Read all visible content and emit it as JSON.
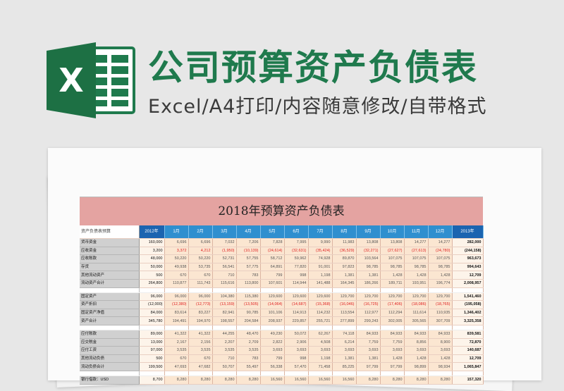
{
  "header": {
    "title": "公司预算资产负债表",
    "subtitle": "Excel/A4打印/内容随意修改/自带格式",
    "logo_letter": "X"
  },
  "colors": {
    "brand_green": "#1f7a4d",
    "sheet_title_bg": "#e4a3a1",
    "month_header": "#2f8fcf",
    "year_header": "#1b64b0",
    "negative": "#e02020"
  },
  "sheet": {
    "title": "2018年预算资产负债表",
    "corner_label": "资产负债表预算",
    "columns": [
      "2012年",
      "1月",
      "2月",
      "3月",
      "4月",
      "5月",
      "6月",
      "7月",
      "8月",
      "9月",
      "10月",
      "11月",
      "12月",
      "2013年"
    ],
    "groups": [
      {
        "rows": [
          {
            "label": "货币资金",
            "first": "160,000",
            "months": [
              "6,696",
              "6,696",
              "7,032",
              "7,206",
              "7,828",
              "7,995",
              "9,990",
              "11,983",
              "13,808",
              "13,808",
              "14,277",
              "14,277"
            ],
            "last": "282,000"
          },
          {
            "label": "应收资金",
            "first": "3,200",
            "months": [
              "3,372",
              "4,212",
              "(1,950)",
              "(10,139)",
              "(24,614)",
              "(32,631)",
              "(35,424)",
              "(36,529)",
              "(32,271)",
              "(27,627)",
              "(27,613)",
              "(24,780)"
            ],
            "last": "(244,158)",
            "neg": true
          },
          {
            "label": "应收账款",
            "first": "48,000",
            "months": [
              "50,220",
              "50,220",
              "52,731",
              "57,755",
              "58,712",
              "59,962",
              "74,928",
              "89,870",
              "103,564",
              "107,075",
              "107,075",
              "107,075"
            ],
            "last": "963,673"
          },
          {
            "label": "存货",
            "first": "50,000",
            "months": [
              "49,938",
              "53,735",
              "56,541",
              "57,775",
              "64,891",
              "77,820",
              "91,001",
              "97,823",
              "98,785",
              "98,785",
              "98,785",
              "98,785"
            ],
            "last": "994,643"
          },
          {
            "label": "其他流动资产",
            "first": "500",
            "months": [
              "670",
              "670",
              "710",
              "783",
              "799",
              "998",
              "1,198",
              "1,381",
              "1,381",
              "1,428",
              "1,428",
              "1,428"
            ],
            "last": "12,709"
          },
          {
            "label": "流动资产合计",
            "first": "264,800",
            "months": [
              "110,877",
              "111,743",
              "115,616",
              "113,800",
              "107,601",
              "114,944",
              "141,488",
              "164,345",
              "186,266",
              "189,711",
              "193,951",
              "196,774"
            ],
            "last": "2,008,957"
          }
        ]
      },
      {
        "rows": [
          {
            "label": "固定资产",
            "first": "96,000",
            "months": [
              "96,000",
              "96,000",
              "104,380",
              "115,380",
              "129,600",
              "129,600",
              "129,600",
              "129,700",
              "129,700",
              "129,700",
              "129,700",
              "129,700"
            ],
            "last": "1,541,460"
          },
          {
            "label": "资产折旧",
            "first": "(12,000)",
            "months": [
              "(12,380)",
              "(12,773)",
              "(13,159)",
              "(13,505)",
              "(14,064)",
              "(14,687)",
              "(15,368)",
              "(16,046)",
              "(16,725)",
              "(17,406)",
              "(18,086)",
              "(18,765)"
            ],
            "last": "(195,058)",
            "neg": true
          },
          {
            "label": "固定资产净值",
            "first": "84,000",
            "months": [
              "83,614",
              "83,227",
              "82,941",
              "90,785",
              "101,106",
              "114,913",
              "114,232",
              "113,554",
              "112,977",
              "112,294",
              "111,614",
              "110,935"
            ],
            "last": "1,346,402"
          },
          {
            "label": "资产合计",
            "first": "345,780",
            "months": [
              "194,491",
              "194,970",
              "198,557",
              "204,584",
              "208,937",
              "229,857",
              "255,721",
              "277,899",
              "299,243",
              "302,005",
              "305,565",
              "307,709"
            ],
            "last": "3,325,358"
          }
        ]
      },
      {
        "rows": [
          {
            "label": "应付账款",
            "first": "89,000",
            "months": [
              "41,322",
              "41,322",
              "44,255",
              "48,470",
              "49,230",
              "50,072",
              "62,267",
              "74,118",
              "84,933",
              "84,933",
              "84,933",
              "84,933"
            ],
            "last": "839,581"
          },
          {
            "label": "应交税金",
            "first": "13,000",
            "months": [
              "2,167",
              "2,156",
              "2,207",
              "2,709",
              "2,822",
              "2,906",
              "4,508",
              "6,214",
              "7,759",
              "7,759",
              "8,856",
              "8,900"
            ],
            "last": "72,870"
          },
          {
            "label": "应付工资",
            "first": "97,000",
            "months": [
              "3,535",
              "3,535",
              "3,535",
              "3,535",
              "3,693",
              "3,693",
              "3,693",
              "3,693",
              "3,693",
              "3,693",
              "3,693",
              "3,693"
            ],
            "last": "140,687"
          },
          {
            "label": "其他流动负债",
            "first": "500",
            "months": [
              "670",
              "670",
              "710",
              "783",
              "799",
              "998",
              "1,198",
              "1,381",
              "1,381",
              "1,428",
              "1,428",
              "1,428"
            ],
            "last": "12,709"
          },
          {
            "label": "流动负债合计",
            "first": "199,500",
            "months": [
              "47,693",
              "47,682",
              "50,707",
              "55,497",
              "56,338",
              "57,470",
              "71,458",
              "85,225",
              "97,799",
              "97,799",
              "98,899",
              "98,934"
            ],
            "last": "1,065,847"
          }
        ]
      },
      {
        "rows": [
          {
            "label": "银行借款：USD",
            "first": "8,700",
            "months": [
              "8,280",
              "8,280",
              "8,280",
              "8,280",
              "16,560",
              "16,560",
              "16,560",
              "16,560",
              "8,280",
              "8,280",
              "8,280",
              "8,280"
            ],
            "last": "157,320"
          }
        ]
      }
    ]
  }
}
